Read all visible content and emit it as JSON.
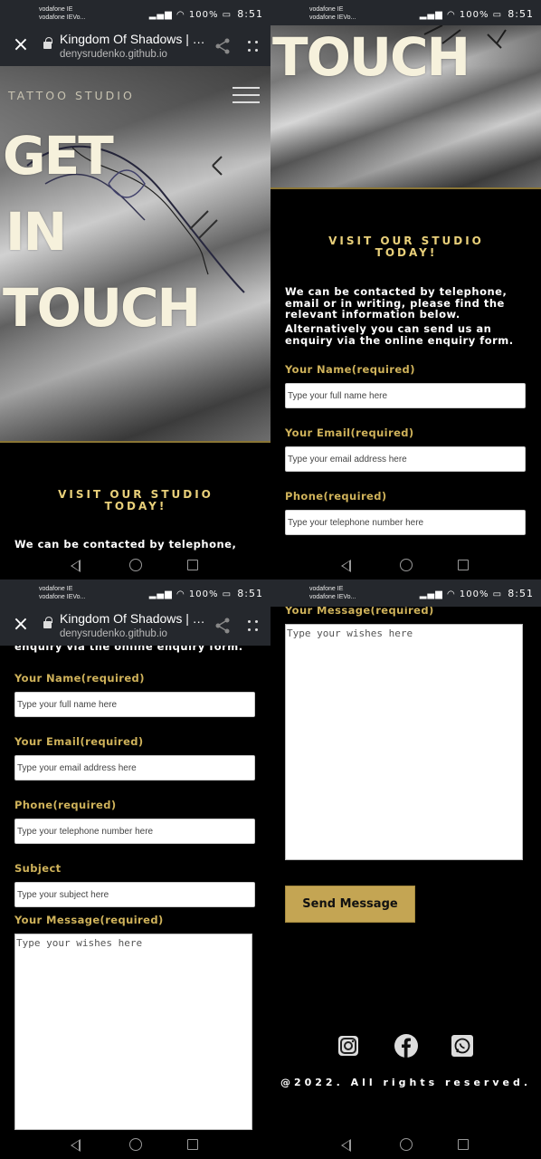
{
  "status": {
    "carrier_line1": "vodafone IE",
    "carrier_line2": "vodafone IEVo...",
    "battery": "100%",
    "time": "8:51"
  },
  "browser": {
    "title": "Kingdom Of Shadows | T...",
    "url": "denysrudenko.github.io"
  },
  "site": {
    "brand": "TATTOO STUDIO",
    "hero_words": [
      "GET",
      "IN",
      "TOUCH"
    ],
    "section_title_line1": "VISIT OUR STUDIO",
    "section_title_line2": "TODAY!",
    "para_p1_line1": "We can be contacted by telephone,",
    "intro_text": "We can be contacted by telephone, email or in writing, please find the relevant information below.",
    "alt_text": "Alternatively you can send us an enquiry via the online enquiry form.",
    "alt_text_tail": "enquiry via the online enquiry form."
  },
  "form": {
    "name_label": "Your Name(required)",
    "name_placeholder": "Type your full name here",
    "email_label": "Your Email(required)",
    "email_placeholder": "Type your email address here",
    "phone_label": "Phone(required)",
    "phone_placeholder": "Type your telephone number here",
    "subject_label": "Subject",
    "subject_placeholder": "Type your subject here",
    "message_label": "Your Message(required)",
    "message_placeholder": "Type your wishes here",
    "send_label": "Send Message"
  },
  "footer": {
    "social": [
      "instagram-icon",
      "facebook-icon",
      "whatsapp-icon"
    ],
    "copyright": "@2022. All rights reserved."
  },
  "colors": {
    "accent_gold": "#c4a553",
    "title_gold": "#e9d07a",
    "label_gold": "#cfb25a",
    "bar_dark": "#25282d"
  }
}
